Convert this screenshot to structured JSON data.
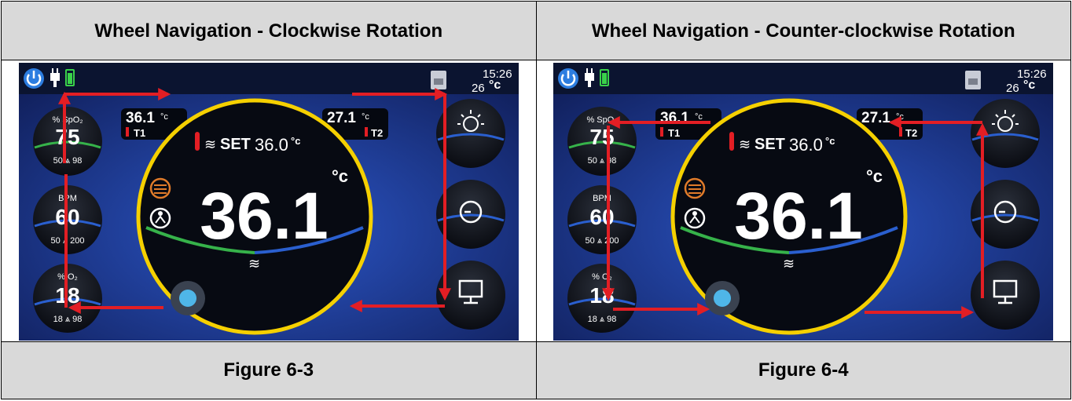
{
  "columns": [
    {
      "title": "Wheel Navigation - Clockwise Rotation",
      "caption": "Figure 6-3",
      "direction": "clockwise"
    },
    {
      "title": "Wheel Navigation - Counter-clockwise Rotation",
      "caption": "Figure 6-4",
      "direction": "counter-clockwise"
    }
  ],
  "device": {
    "time": "15:26",
    "ambient_temp": "26",
    "ambient_unit": "°c",
    "spo2_label": "% SpO₂",
    "spo2_value": "75",
    "spo2_limits": "50 ⩓ 98",
    "bpm_label": "BPM",
    "bpm_value": "60",
    "bpm_limits": "50 ⩓ 200",
    "o2_label": "% O₂",
    "o2_value": "18",
    "o2_limits": "18 ⩓ 98",
    "t1_value": "36.1",
    "t1_unit": "°c",
    "t1_label": "T1",
    "t2_value": "27.1",
    "t2_unit": "°c",
    "t2_label": "T2",
    "set_label": "SET",
    "set_value": "36.0",
    "set_unit": "°c",
    "main_temp": "36.1",
    "main_unit": "°c"
  },
  "colors": {
    "arrow": "#e31e24",
    "ring": "#f5d000",
    "screen_bg": "#12205a",
    "green_bar": "#36b24a",
    "blue_bar": "#2a5fcf"
  }
}
